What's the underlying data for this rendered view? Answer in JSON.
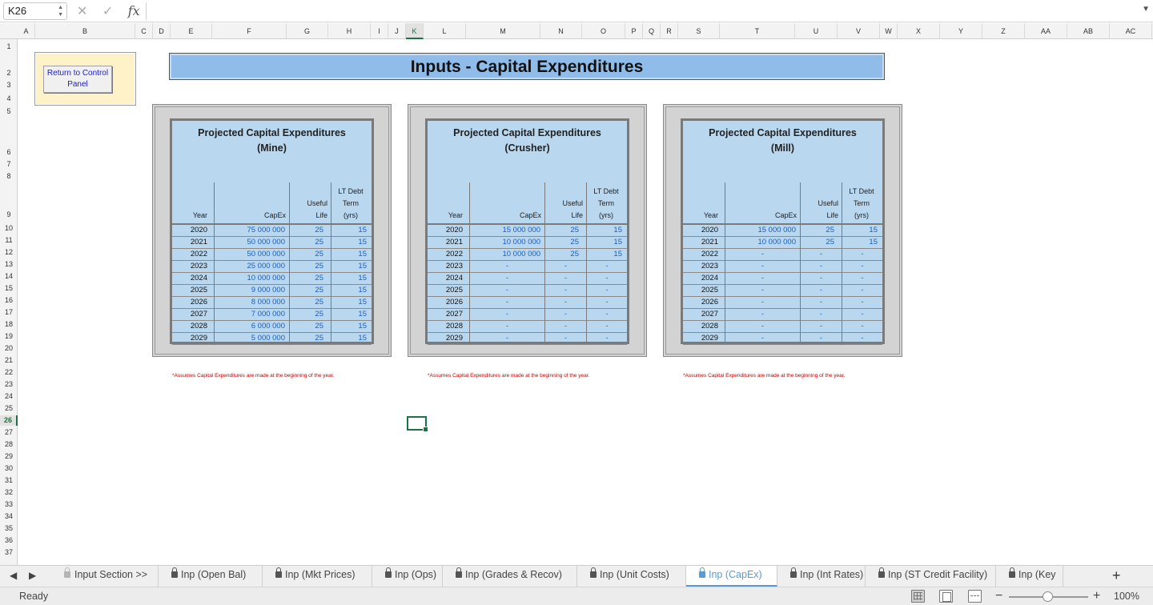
{
  "formula_bar": {
    "name_box": "K26",
    "fx": "fx",
    "cancel": "✕",
    "enter": "✓",
    "content": ""
  },
  "columns": [
    "A",
    "B",
    "C",
    "D",
    "E",
    "F",
    "G",
    "H",
    "I",
    "J",
    "K",
    "L",
    "M",
    "N",
    "O",
    "P",
    "Q",
    "R",
    "S",
    "T",
    "U",
    "V",
    "W",
    "X",
    "Y",
    "Z",
    "AA",
    "AB",
    "AC"
  ],
  "rows": [
    "1",
    "2",
    "3",
    "4",
    "5",
    "6",
    "7",
    "8",
    "9",
    "10",
    "11",
    "12",
    "13",
    "14",
    "15",
    "16",
    "17",
    "18",
    "19",
    "20",
    "21",
    "22",
    "23",
    "24",
    "25",
    "26",
    "27",
    "28",
    "29",
    "30",
    "31",
    "32",
    "33",
    "34",
    "35",
    "36",
    "37"
  ],
  "selected_cell": {
    "column": "K",
    "row": "26"
  },
  "control_button": {
    "label": "Return to Control Panel"
  },
  "page_title": "Inputs - Capital Expenditures",
  "table_headers": {
    "year": "Year",
    "capex": "CapEx",
    "useful_life": "Useful Life",
    "lt_debt": "LT Debt Term (yrs)"
  },
  "panels": [
    {
      "title": "Projected Capital Expenditures",
      "subtitle": "(Mine)",
      "rows": [
        {
          "year": "2020",
          "capex": "75 000 000",
          "life": "25",
          "term": "15"
        },
        {
          "year": "2021",
          "capex": "50 000 000",
          "life": "25",
          "term": "15"
        },
        {
          "year": "2022",
          "capex": "50 000 000",
          "life": "25",
          "term": "15"
        },
        {
          "year": "2023",
          "capex": "25 000 000",
          "life": "25",
          "term": "15"
        },
        {
          "year": "2024",
          "capex": "10 000 000",
          "life": "25",
          "term": "15"
        },
        {
          "year": "2025",
          "capex": "9 000 000",
          "life": "25",
          "term": "15"
        },
        {
          "year": "2026",
          "capex": "8 000 000",
          "life": "25",
          "term": "15"
        },
        {
          "year": "2027",
          "capex": "7 000 000",
          "life": "25",
          "term": "15"
        },
        {
          "year": "2028",
          "capex": "6 000 000",
          "life": "25",
          "term": "15"
        },
        {
          "year": "2029",
          "capex": "5 000 000",
          "life": "25",
          "term": "15"
        }
      ],
      "note": "*Assumes Capital Expenditures are made at the beginning of the year."
    },
    {
      "title": "Projected Capital Expenditures",
      "subtitle": "(Crusher)",
      "rows": [
        {
          "year": "2020",
          "capex": "15 000 000",
          "life": "25",
          "term": "15"
        },
        {
          "year": "2021",
          "capex": "10 000 000",
          "life": "25",
          "term": "15"
        },
        {
          "year": "2022",
          "capex": "10 000 000",
          "life": "25",
          "term": "15"
        },
        {
          "year": "2023",
          "capex": "-",
          "life": "-",
          "term": "-"
        },
        {
          "year": "2024",
          "capex": "-",
          "life": "-",
          "term": "-"
        },
        {
          "year": "2025",
          "capex": "-",
          "life": "-",
          "term": "-"
        },
        {
          "year": "2026",
          "capex": "-",
          "life": "-",
          "term": "-"
        },
        {
          "year": "2027",
          "capex": "-",
          "life": "-",
          "term": "-"
        },
        {
          "year": "2028",
          "capex": "-",
          "life": "-",
          "term": "-"
        },
        {
          "year": "2029",
          "capex": "-",
          "life": "-",
          "term": "-"
        }
      ],
      "note": "*Assumes Capital Expenditures are made at the beginning of the year."
    },
    {
      "title": "Projected Capital Expenditures",
      "subtitle": "(Mill)",
      "rows": [
        {
          "year": "2020",
          "capex": "15 000 000",
          "life": "25",
          "term": "15"
        },
        {
          "year": "2021",
          "capex": "10 000 000",
          "life": "25",
          "term": "15"
        },
        {
          "year": "2022",
          "capex": "-",
          "life": "-",
          "term": "-"
        },
        {
          "year": "2023",
          "capex": "-",
          "life": "-",
          "term": "-"
        },
        {
          "year": "2024",
          "capex": "-",
          "life": "-",
          "term": "-"
        },
        {
          "year": "2025",
          "capex": "-",
          "life": "-",
          "term": "-"
        },
        {
          "year": "2026",
          "capex": "-",
          "life": "-",
          "term": "-"
        },
        {
          "year": "2027",
          "capex": "-",
          "life": "-",
          "term": "-"
        },
        {
          "year": "2028",
          "capex": "-",
          "life": "-",
          "term": "-"
        },
        {
          "year": "2029",
          "capex": "-",
          "life": "-",
          "term": "-"
        }
      ],
      "note": "*Assumes Capital Expenditures are made at the beginning of the year."
    }
  ],
  "sheet_tabs": [
    {
      "label": "Input Section >>",
      "active": false,
      "lock": "light"
    },
    {
      "label": "Inp (Open Bal)",
      "active": false,
      "lock": "dark"
    },
    {
      "label": "Inp (Mkt Prices)",
      "active": false,
      "lock": "dark"
    },
    {
      "label": "Inp (Ops)",
      "active": false,
      "lock": "dark"
    },
    {
      "label": "Inp (Grades & Recov)",
      "active": false,
      "lock": "dark"
    },
    {
      "label": "Inp (Unit Costs)",
      "active": false,
      "lock": "dark"
    },
    {
      "label": "Inp (CapEx)",
      "active": true,
      "lock": "dark"
    },
    {
      "label": "Inp (Int Rates)",
      "active": false,
      "lock": "dark"
    },
    {
      "label": "Inp (ST Credit Facility)",
      "active": false,
      "lock": "dark"
    },
    {
      "label": "Inp (Key",
      "active": false,
      "lock": "dark"
    }
  ],
  "tab_nav": {
    "prev": "◀",
    "next": "▶",
    "add": "+"
  },
  "status": {
    "text": "Ready",
    "zoom": "100%",
    "zoom_minus": "−",
    "zoom_plus": "+",
    "zoom_level": 1.0
  },
  "colors": {
    "accent": "#1e7145",
    "table_fill": "#b9d7ef",
    "title_fill": "#8fbce8",
    "input_blue": "#1b5fc4",
    "note_red": "#c00000",
    "button_frame": "#fff2c9"
  }
}
